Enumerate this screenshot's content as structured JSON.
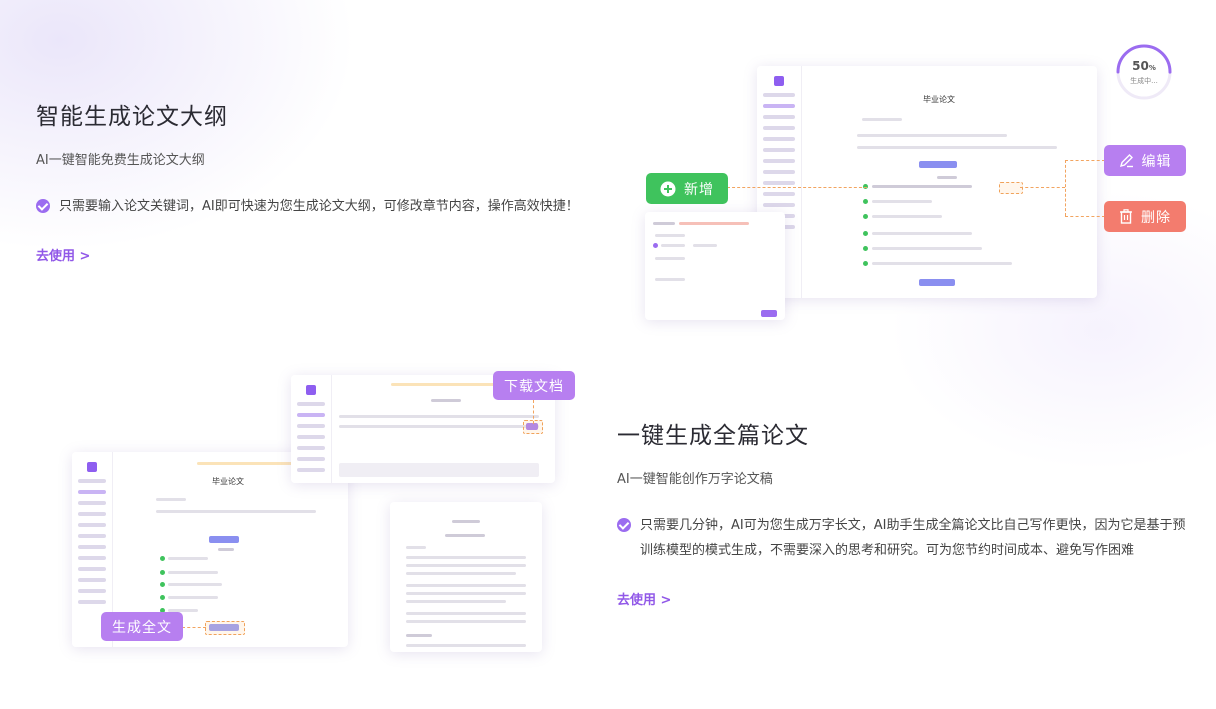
{
  "section1": {
    "title": "智能生成论文大纲",
    "subtitle": "AI一键智能免费生成论文大纲",
    "bullet": "只需要输入论文关键词，AI即可快速为您生成论文大纲，可修改章节内容，操作高效快捷！",
    "link": "去使用 >"
  },
  "section2": {
    "title": "一键生成全篇论文",
    "subtitle": "AI一键智能创作万字论文稿",
    "bullet": "只需要几分钟，AI可为您生成万字长文，AI助手生成全篇论文比自己写作更快，因为它是基于预训练模型的模式生成，不需要深入的思考和研究。可为您节约时间成本、避免写作困难",
    "link": "去使用 >"
  },
  "buttons": {
    "add": "新增",
    "edit": "编辑",
    "delete": "删除",
    "download": "下载文档",
    "generate": "生成全文"
  },
  "progress": {
    "value": "50",
    "unit": "%",
    "label": "生成中...",
    "fraction": 0.5
  },
  "mockups": {
    "outline_title": "毕业论文",
    "paper_title": "毕业论文"
  },
  "colors": {
    "accent": "#9158e8",
    "add_green": "#3fc35d",
    "edit_purple": "#b77ff0",
    "delete_red": "#f37c6e"
  }
}
